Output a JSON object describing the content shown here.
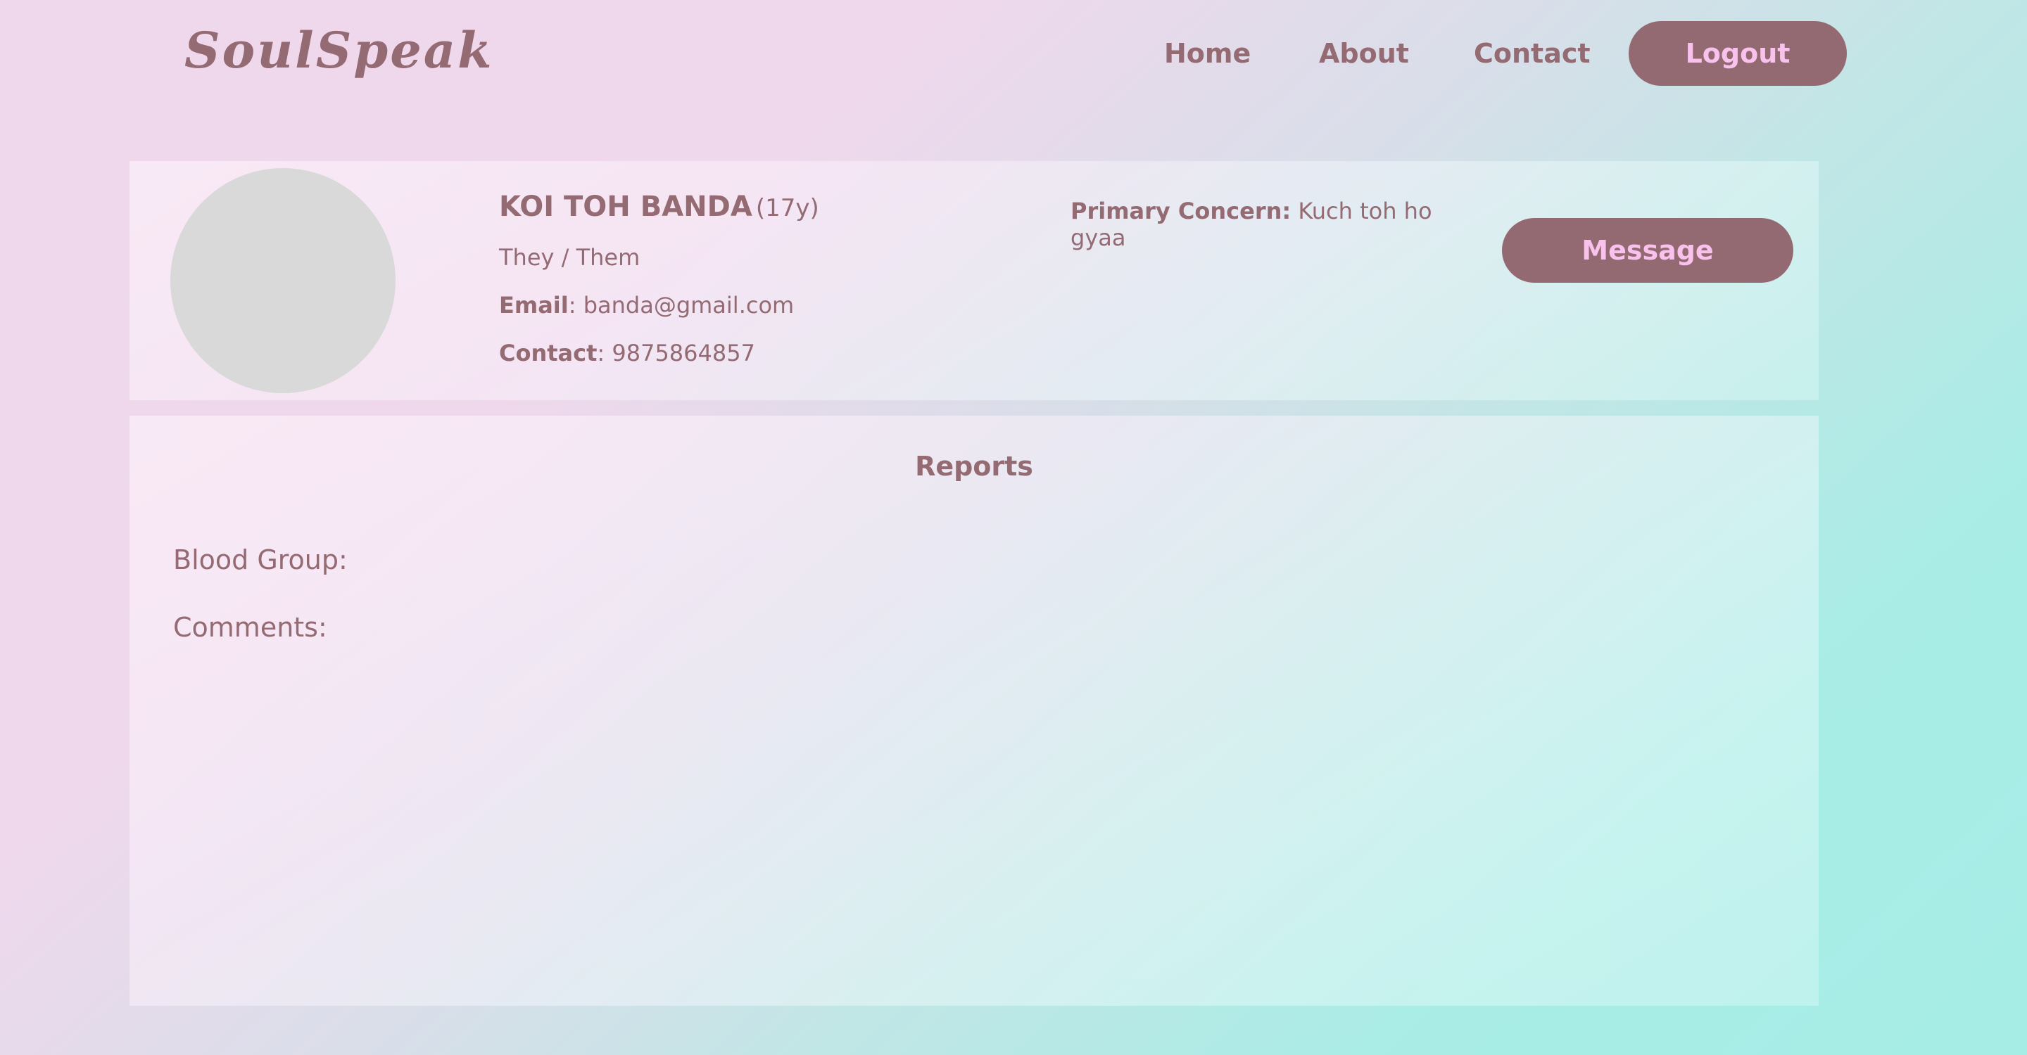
{
  "header": {
    "logo": "SoulSpeak",
    "nav": {
      "home": "Home",
      "about": "About",
      "contact": "Contact"
    },
    "logout_label": "Logout"
  },
  "profile": {
    "name": "KOI TOH BANDA",
    "age": "(17y)",
    "pronouns": "They / Them",
    "email_label": "Email",
    "email_value": ": banda@gmail.com",
    "contact_label": "Contact",
    "contact_value": ": 9875864857",
    "concern_label": "Primary Concern:",
    "concern_value": " Kuch toh ho gyaa",
    "message_label": "Message"
  },
  "reports": {
    "title": "Reports",
    "blood_group_label": "Blood Group:",
    "comments_label": "Comments:"
  },
  "colors": {
    "text": "#946a73",
    "button_bg": "#936972",
    "button_text": "#f8c2ec",
    "avatar_placeholder": "#d9d9d9"
  }
}
